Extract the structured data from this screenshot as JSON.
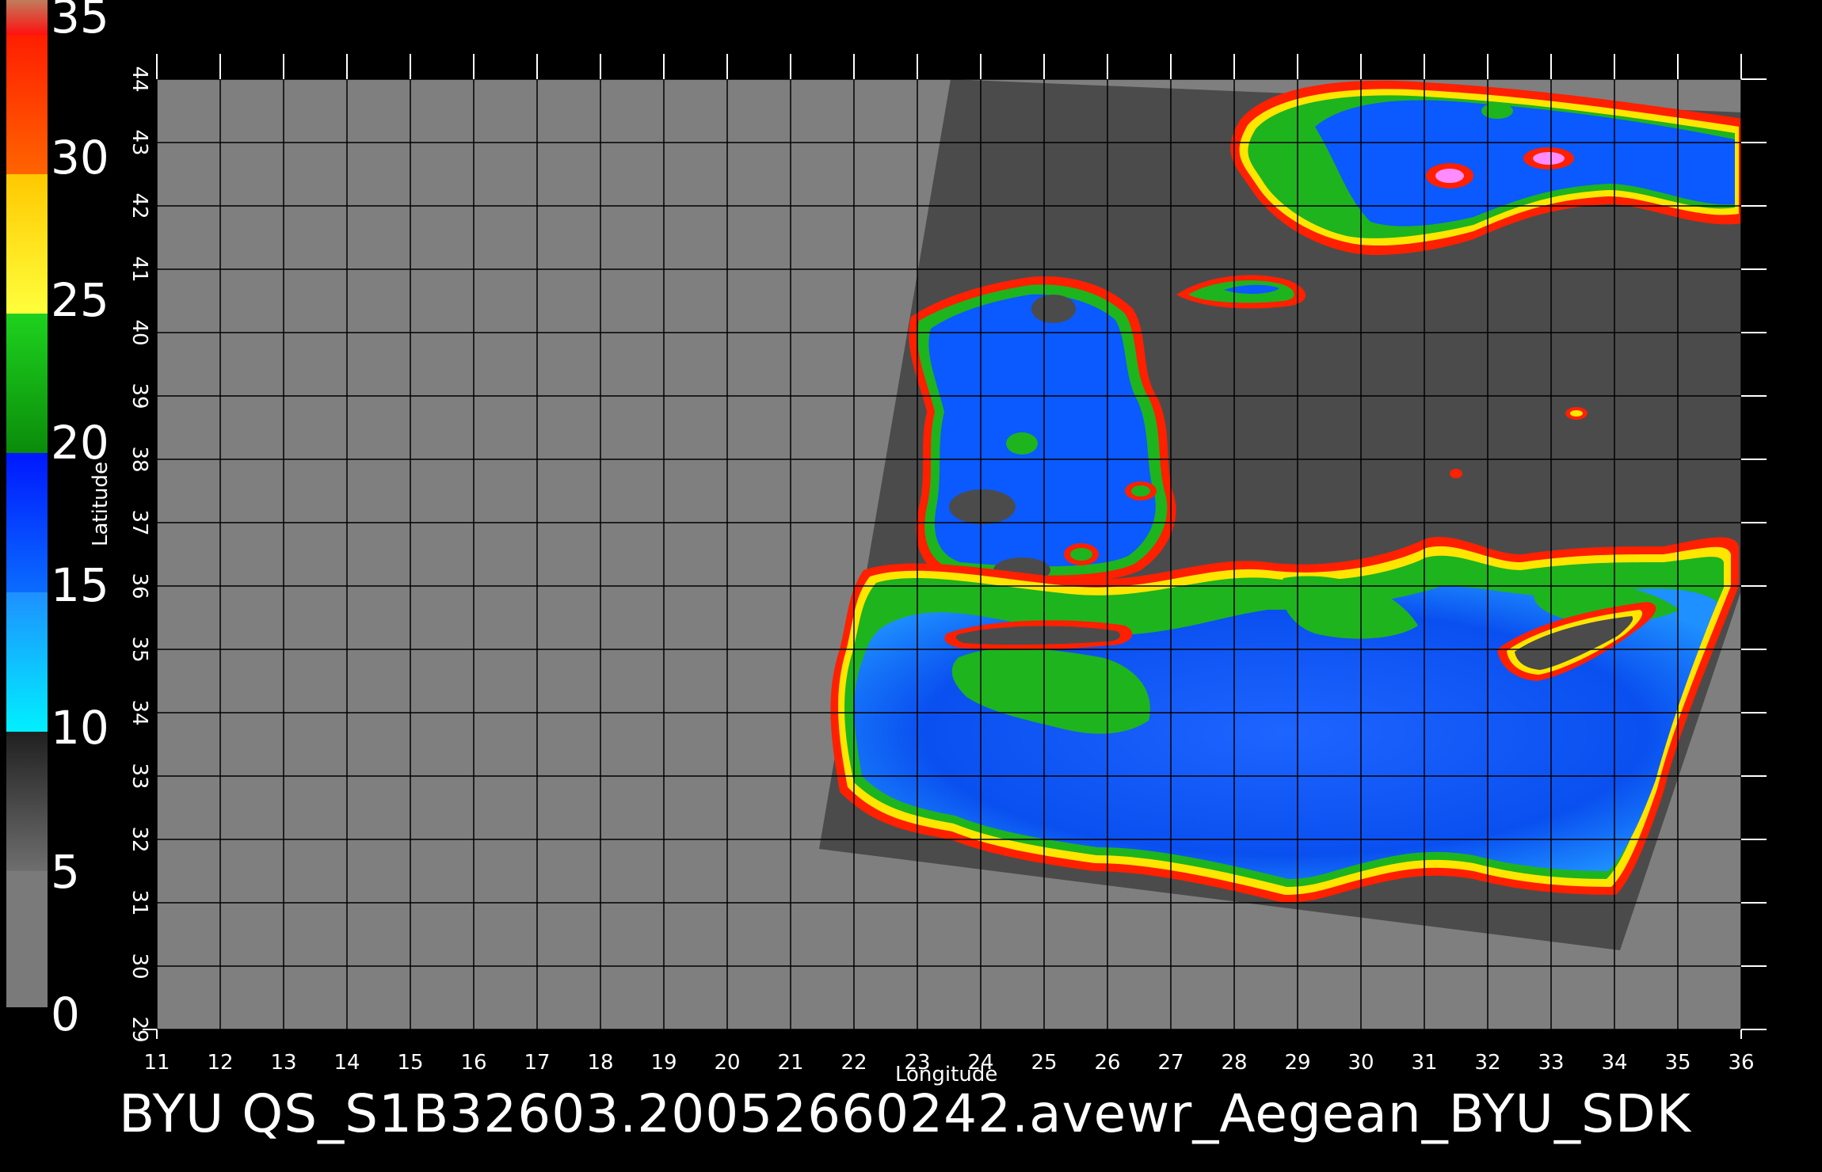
{
  "colorbar": {
    "ticks": [
      "35",
      "30",
      "25",
      "20",
      "15",
      "10",
      "5",
      "0"
    ],
    "segments": [
      {
        "from": 0,
        "to": 5,
        "color_top": "#202020",
        "color_bottom": "#6e6e6e"
      },
      {
        "from": 5,
        "to": 10,
        "color_top": "#1e90ff",
        "color_bottom": "#00f0ff"
      },
      {
        "from": 10,
        "to": 15,
        "color_top": "#0018ff",
        "color_bottom": "#0a6cff"
      },
      {
        "from": 15,
        "to": 20,
        "color_top": "#1ed21e",
        "color_bottom": "#0a8c0a"
      },
      {
        "from": 20,
        "to": 25,
        "color_top": "#ffc800",
        "color_bottom": "#ffff3c"
      },
      {
        "from": 25,
        "to": 30,
        "color_top": "#ff1e00",
        "color_bottom": "#ff6400"
      },
      {
        "from": 30,
        "to": 35,
        "color_top": "#c07c5c",
        "color_bottom": "#ff1010"
      }
    ]
  },
  "map": {
    "x_ticks": [
      "11",
      "12",
      "13",
      "14",
      "15",
      "16",
      "17",
      "18",
      "19",
      "20",
      "21",
      "22",
      "23",
      "24",
      "25",
      "26",
      "27",
      "28",
      "29",
      "30",
      "31",
      "32",
      "33",
      "34",
      "35",
      "36"
    ],
    "y_ticks": [
      "29",
      "30",
      "31",
      "32",
      "33",
      "34",
      "35",
      "36",
      "37",
      "38",
      "39",
      "40",
      "41",
      "42",
      "43",
      "44"
    ],
    "x_range": [
      11,
      36
    ],
    "y_range": [
      29,
      44
    ],
    "xlabel": "Longitude",
    "ylabel": "Latitude",
    "grid": true,
    "colors": {
      "background_land": "#7f7f7f",
      "swath": "#4b4b4b",
      "grid": "#000000",
      "sea_blue": "#0a5aff",
      "coast_green": "#1eb41e",
      "coast_yellow": "#ffe600",
      "coast_red": "#ff2000"
    }
  },
  "footer": {
    "title": "BYU  QS_S1B32603.20052660242.avewr_Aegean_BYU_SDK"
  }
}
